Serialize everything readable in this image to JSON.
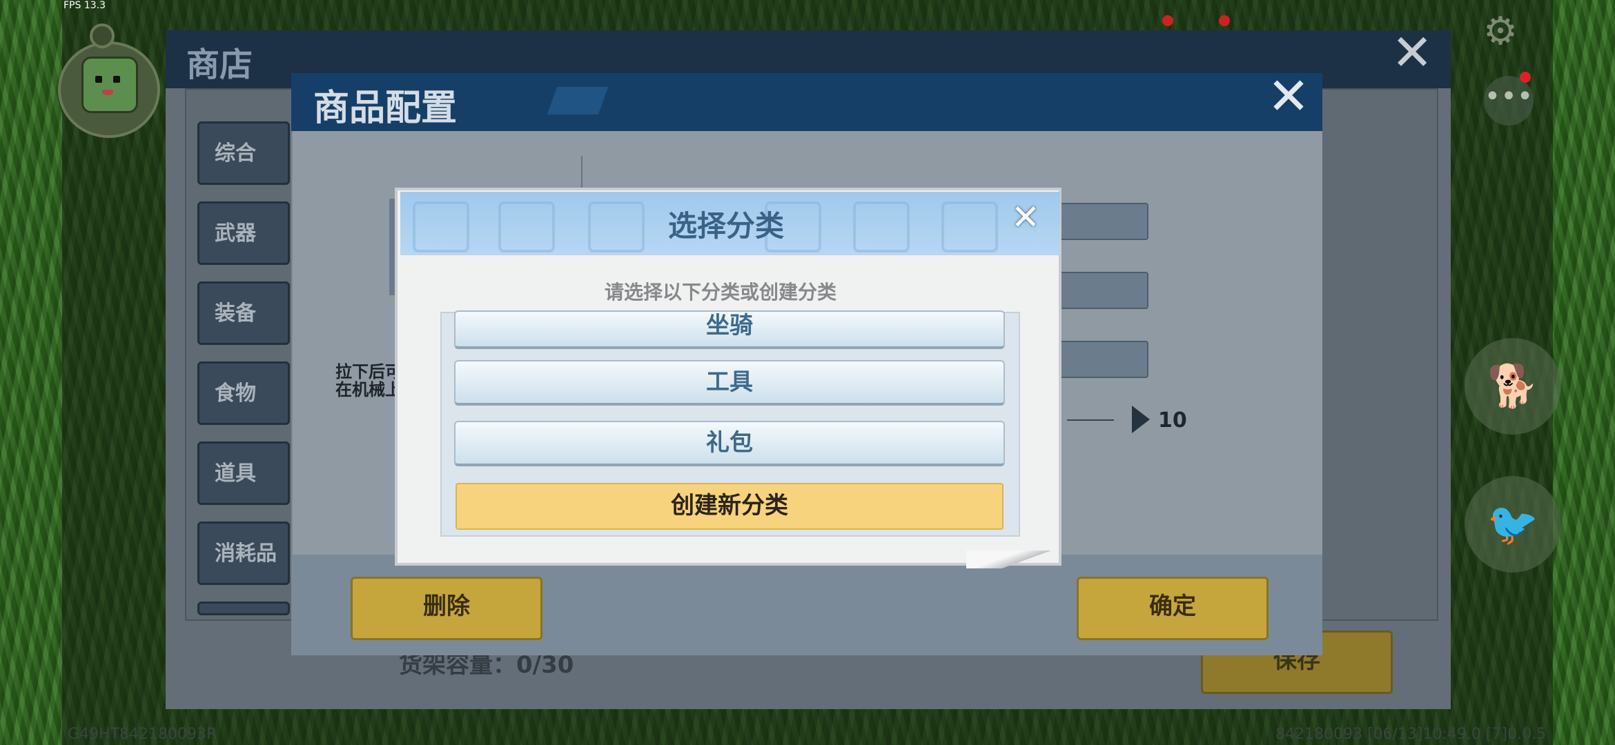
{
  "hud": {
    "fps": "FPS 13.3",
    "device_id": "G49HT842180093R",
    "status_line": "842180093  [06/13]10:49.0  [7]0.0.5"
  },
  "shop": {
    "title": "商店",
    "categories": [
      "综合",
      "武器",
      "装备",
      "食物",
      "道具",
      "消耗品"
    ],
    "capacity_label": "货架容量：0/30",
    "save_label": "保存"
  },
  "config": {
    "title": "商品配置",
    "hint_line1": "拉下后可",
    "hint_line2": "在机械上",
    "slider_value": "10",
    "delete_label": "删除",
    "ok_label": "确定"
  },
  "select_category": {
    "title": "选择分类",
    "subtitle": "请选择以下分类或创建分类",
    "items": [
      "坐骑",
      "工具",
      "礼包"
    ],
    "create_label": "创建新分类"
  },
  "icons": {
    "close": "✕",
    "gear": "⚙",
    "more": "•••",
    "pet": "🐕",
    "bird": "🐦"
  },
  "colors": {
    "header_blue": "#163f67",
    "accent_yellow": "#c5a63c",
    "create_yellow": "#f7d37d"
  }
}
